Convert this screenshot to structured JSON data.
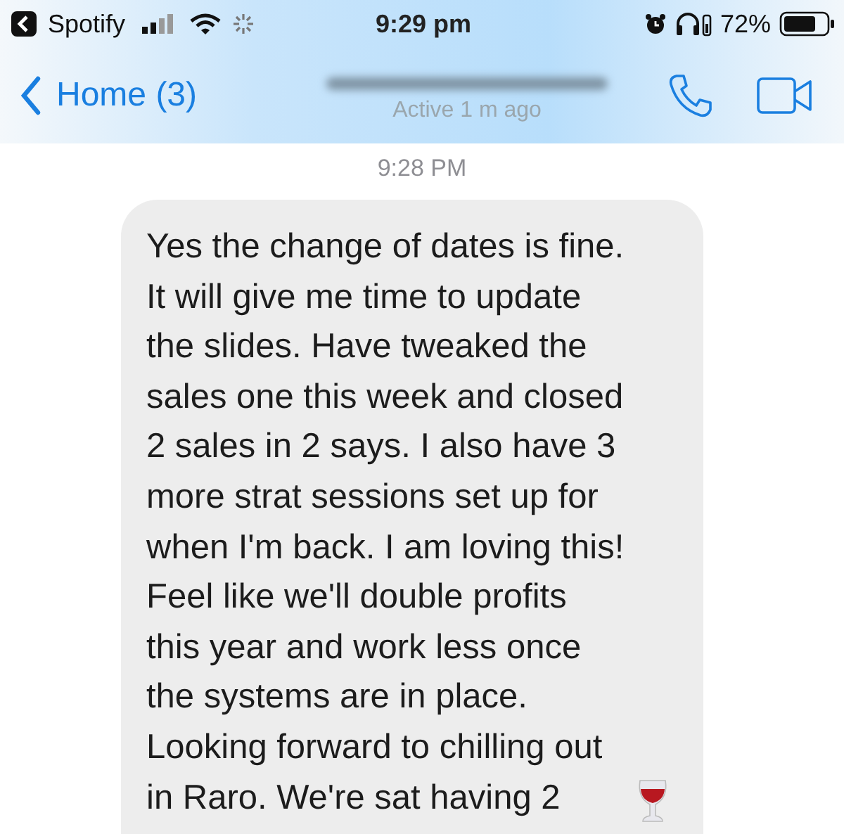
{
  "status_bar": {
    "back_app": "Spotify",
    "time": "9:29 pm",
    "battery": "72%"
  },
  "nav": {
    "back_label": "Home (3)",
    "subtitle": "Active 1 m ago"
  },
  "timestamp": "9:28 PM",
  "message": {
    "lines": [
      "Yes the change of dates is fine.",
      "It will give me time to update",
      "the slides. Have tweaked the",
      "sales one this week and closed",
      "2 sales in 2 says. I also have 3",
      "more strat sessions set up for",
      "when I'm back. I am loving this!",
      "Feel like we'll double profits",
      "this year and work less once",
      "the systems are in place.",
      "Looking forward to chilling out",
      "in Raro. We're sat having 2"
    ]
  }
}
